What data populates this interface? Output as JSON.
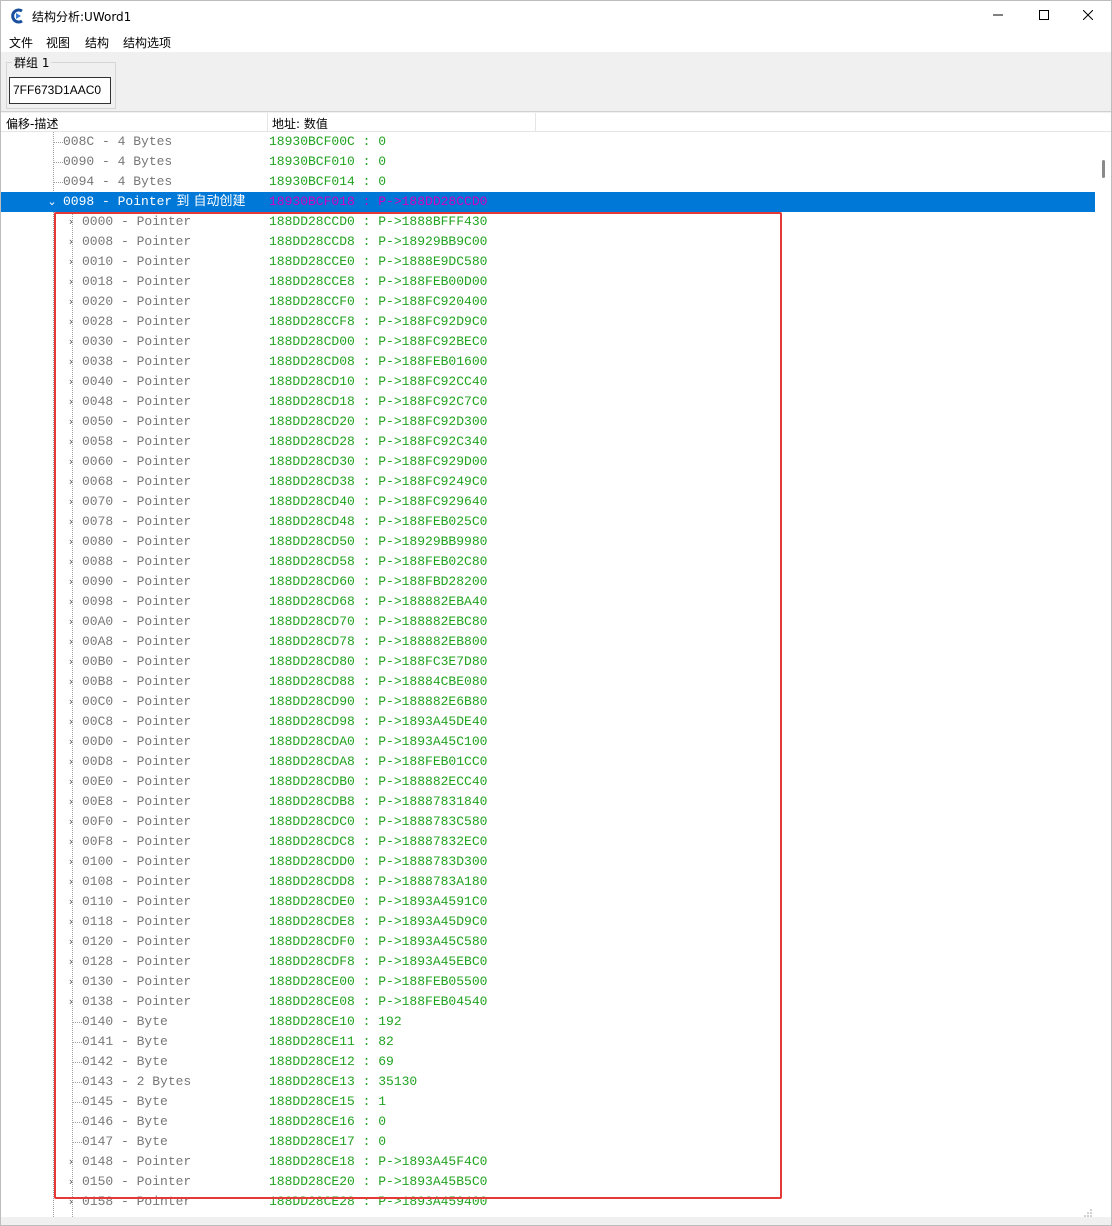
{
  "window": {
    "title": "结构分析:UWord1",
    "icon": "cheat-engine-icon",
    "controls": {
      "minimize": "minimize-icon",
      "maximize": "maximize-icon",
      "close": "close-icon"
    }
  },
  "menubar": {
    "items": [
      "文件",
      "视图",
      "结构",
      "结构选项"
    ]
  },
  "group": {
    "title": "群组 1",
    "address": "7FF673D1AAC0"
  },
  "columns": {
    "offset_desc": "偏移-描述",
    "address_value": "地址: 数值"
  },
  "colors": {
    "selection": "#0078d7",
    "address_text": "#22a322",
    "selected_value": "#d000c0",
    "highlight_border": "#e53935"
  },
  "rows": [
    {
      "offset": "008C - 4 Bytes",
      "addr": "18930BCF00C : 0",
      "level": 0,
      "expandable": false
    },
    {
      "offset": "0090 - 4 Bytes",
      "addr": "18930BCF010 : 0",
      "level": 0,
      "expandable": false
    },
    {
      "offset": "0094 - 4 Bytes",
      "addr": "18930BCF014 : 0",
      "level": 0,
      "expandable": false
    },
    {
      "offset": "0098 - Pointer",
      "suffix": "到 自动创建",
      "addr": "18930BCF018 : P->188DD28CCD0",
      "level": 0,
      "expandable": true,
      "expanded": true,
      "selected": true
    },
    {
      "offset": "0000 - Pointer",
      "addr": "188DD28CCD0 : P->1888BFFF430",
      "level": 1,
      "expandable": true
    },
    {
      "offset": "0008 - Pointer",
      "addr": "188DD28CCD8 : P->18929BB9C00",
      "level": 1,
      "expandable": true
    },
    {
      "offset": "0010 - Pointer",
      "addr": "188DD28CCE0 : P->1888E9DC580",
      "level": 1,
      "expandable": true
    },
    {
      "offset": "0018 - Pointer",
      "addr": "188DD28CCE8 : P->188FEB00D00",
      "level": 1,
      "expandable": true
    },
    {
      "offset": "0020 - Pointer",
      "addr": "188DD28CCF0 : P->188FC920400",
      "level": 1,
      "expandable": true
    },
    {
      "offset": "0028 - Pointer",
      "addr": "188DD28CCF8 : P->188FC92D9C0",
      "level": 1,
      "expandable": true
    },
    {
      "offset": "0030 - Pointer",
      "addr": "188DD28CD00 : P->188FC92BEC0",
      "level": 1,
      "expandable": true
    },
    {
      "offset": "0038 - Pointer",
      "addr": "188DD28CD08 : P->188FEB01600",
      "level": 1,
      "expandable": true
    },
    {
      "offset": "0040 - Pointer",
      "addr": "188DD28CD10 : P->188FC92CC40",
      "level": 1,
      "expandable": true
    },
    {
      "offset": "0048 - Pointer",
      "addr": "188DD28CD18 : P->188FC92C7C0",
      "level": 1,
      "expandable": true
    },
    {
      "offset": "0050 - Pointer",
      "addr": "188DD28CD20 : P->188FC92D300",
      "level": 1,
      "expandable": true
    },
    {
      "offset": "0058 - Pointer",
      "addr": "188DD28CD28 : P->188FC92C340",
      "level": 1,
      "expandable": true
    },
    {
      "offset": "0060 - Pointer",
      "addr": "188DD28CD30 : P->188FC929D00",
      "level": 1,
      "expandable": true
    },
    {
      "offset": "0068 - Pointer",
      "addr": "188DD28CD38 : P->188FC9249C0",
      "level": 1,
      "expandable": true
    },
    {
      "offset": "0070 - Pointer",
      "addr": "188DD28CD40 : P->188FC929640",
      "level": 1,
      "expandable": true
    },
    {
      "offset": "0078 - Pointer",
      "addr": "188DD28CD48 : P->188FEB025C0",
      "level": 1,
      "expandable": true
    },
    {
      "offset": "0080 - Pointer",
      "addr": "188DD28CD50 : P->18929BB9980",
      "level": 1,
      "expandable": true
    },
    {
      "offset": "0088 - Pointer",
      "addr": "188DD28CD58 : P->188FEB02C80",
      "level": 1,
      "expandable": true
    },
    {
      "offset": "0090 - Pointer",
      "addr": "188DD28CD60 : P->188FBD28200",
      "level": 1,
      "expandable": true
    },
    {
      "offset": "0098 - Pointer",
      "addr": "188DD28CD68 : P->188882EBA40",
      "level": 1,
      "expandable": true
    },
    {
      "offset": "00A0 - Pointer",
      "addr": "188DD28CD70 : P->188882EBC80",
      "level": 1,
      "expandable": true
    },
    {
      "offset": "00A8 - Pointer",
      "addr": "188DD28CD78 : P->188882EB800",
      "level": 1,
      "expandable": true
    },
    {
      "offset": "00B0 - Pointer",
      "addr": "188DD28CD80 : P->188FC3E7D80",
      "level": 1,
      "expandable": true
    },
    {
      "offset": "00B8 - Pointer",
      "addr": "188DD28CD88 : P->18884CBE080",
      "level": 1,
      "expandable": true
    },
    {
      "offset": "00C0 - Pointer",
      "addr": "188DD28CD90 : P->188882E6B80",
      "level": 1,
      "expandable": true
    },
    {
      "offset": "00C8 - Pointer",
      "addr": "188DD28CD98 : P->1893A45DE40",
      "level": 1,
      "expandable": true
    },
    {
      "offset": "00D0 - Pointer",
      "addr": "188DD28CDA0 : P->1893A45C100",
      "level": 1,
      "expandable": true
    },
    {
      "offset": "00D8 - Pointer",
      "addr": "188DD28CDA8 : P->188FEB01CC0",
      "level": 1,
      "expandable": true
    },
    {
      "offset": "00E0 - Pointer",
      "addr": "188DD28CDB0 : P->188882ECC40",
      "level": 1,
      "expandable": true
    },
    {
      "offset": "00E8 - Pointer",
      "addr": "188DD28CDB8 : P->18887831840",
      "level": 1,
      "expandable": true
    },
    {
      "offset": "00F0 - Pointer",
      "addr": "188DD28CDC0 : P->1888783C580",
      "level": 1,
      "expandable": true
    },
    {
      "offset": "00F8 - Pointer",
      "addr": "188DD28CDC8 : P->18887832EC0",
      "level": 1,
      "expandable": true
    },
    {
      "offset": "0100 - Pointer",
      "addr": "188DD28CDD0 : P->1888783D300",
      "level": 1,
      "expandable": true
    },
    {
      "offset": "0108 - Pointer",
      "addr": "188DD28CDD8 : P->1888783A180",
      "level": 1,
      "expandable": true
    },
    {
      "offset": "0110 - Pointer",
      "addr": "188DD28CDE0 : P->1893A4591C0",
      "level": 1,
      "expandable": true
    },
    {
      "offset": "0118 - Pointer",
      "addr": "188DD28CDE8 : P->1893A45D9C0",
      "level": 1,
      "expandable": true
    },
    {
      "offset": "0120 - Pointer",
      "addr": "188DD28CDF0 : P->1893A45C580",
      "level": 1,
      "expandable": true
    },
    {
      "offset": "0128 - Pointer",
      "addr": "188DD28CDF8 : P->1893A45EBC0",
      "level": 1,
      "expandable": true
    },
    {
      "offset": "0130 - Pointer",
      "addr": "188DD28CE00 : P->188FEB05500",
      "level": 1,
      "expandable": true
    },
    {
      "offset": "0138 - Pointer",
      "addr": "188DD28CE08 : P->188FEB04540",
      "level": 1,
      "expandable": true
    },
    {
      "offset": "0140 - Byte",
      "addr": "188DD28CE10 : 192",
      "level": 1,
      "expandable": false
    },
    {
      "offset": "0141 - Byte",
      "addr": "188DD28CE11 : 82",
      "level": 1,
      "expandable": false
    },
    {
      "offset": "0142 - Byte",
      "addr": "188DD28CE12 : 69",
      "level": 1,
      "expandable": false
    },
    {
      "offset": "0143 - 2 Bytes",
      "addr": "188DD28CE13 : 35130",
      "level": 1,
      "expandable": false
    },
    {
      "offset": "0145 - Byte",
      "addr": "188DD28CE15 : 1",
      "level": 1,
      "expandable": false
    },
    {
      "offset": "0146 - Byte",
      "addr": "188DD28CE16 : 0",
      "level": 1,
      "expandable": false
    },
    {
      "offset": "0147 - Byte",
      "addr": "188DD28CE17 : 0",
      "level": 1,
      "expandable": false
    },
    {
      "offset": "0148 - Pointer",
      "addr": "188DD28CE18 : P->1893A45F4C0",
      "level": 1,
      "expandable": true
    },
    {
      "offset": "0150 - Pointer",
      "addr": "188DD28CE20 : P->1893A45B5C0",
      "level": 1,
      "expandable": true
    },
    {
      "offset": "0158 - Pointer",
      "addr": "188DD28CE28 : P->1893A459400",
      "level": 1,
      "expandable": true
    }
  ]
}
